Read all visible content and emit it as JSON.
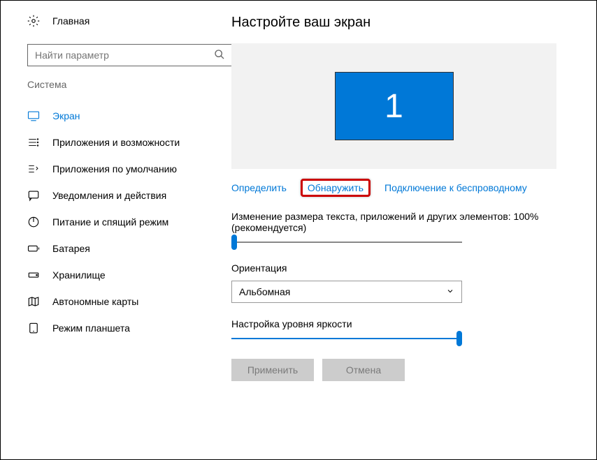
{
  "home": {
    "label": "Главная"
  },
  "search": {
    "placeholder": "Найти параметр"
  },
  "category": "Система",
  "nav": [
    {
      "key": "display",
      "label": "Экран",
      "active": true
    },
    {
      "key": "apps",
      "label": "Приложения и возможности"
    },
    {
      "key": "default-apps",
      "label": "Приложения по умолчанию"
    },
    {
      "key": "notifications",
      "label": "Уведомления и действия"
    },
    {
      "key": "power",
      "label": "Питание и спящий режим"
    },
    {
      "key": "battery",
      "label": "Батарея"
    },
    {
      "key": "storage",
      "label": "Хранилище"
    },
    {
      "key": "maps",
      "label": "Автономные карты"
    },
    {
      "key": "tablet",
      "label": "Режим планшета"
    }
  ],
  "main": {
    "title": "Настройте ваш экран",
    "monitor_number": "1",
    "links": {
      "identify": "Определить",
      "detect": "Обнаружить",
      "wireless": "Подключение к беспроводному"
    },
    "scaling_label": "Изменение размера текста, приложений и других элементов: 100% (рекомендуется)",
    "scaling_value": 0,
    "orientation_label": "Ориентация",
    "orientation_value": "Альбомная",
    "brightness_label": "Настройка уровня яркости",
    "brightness_value": 100,
    "apply": "Применить",
    "cancel": "Отмена"
  }
}
